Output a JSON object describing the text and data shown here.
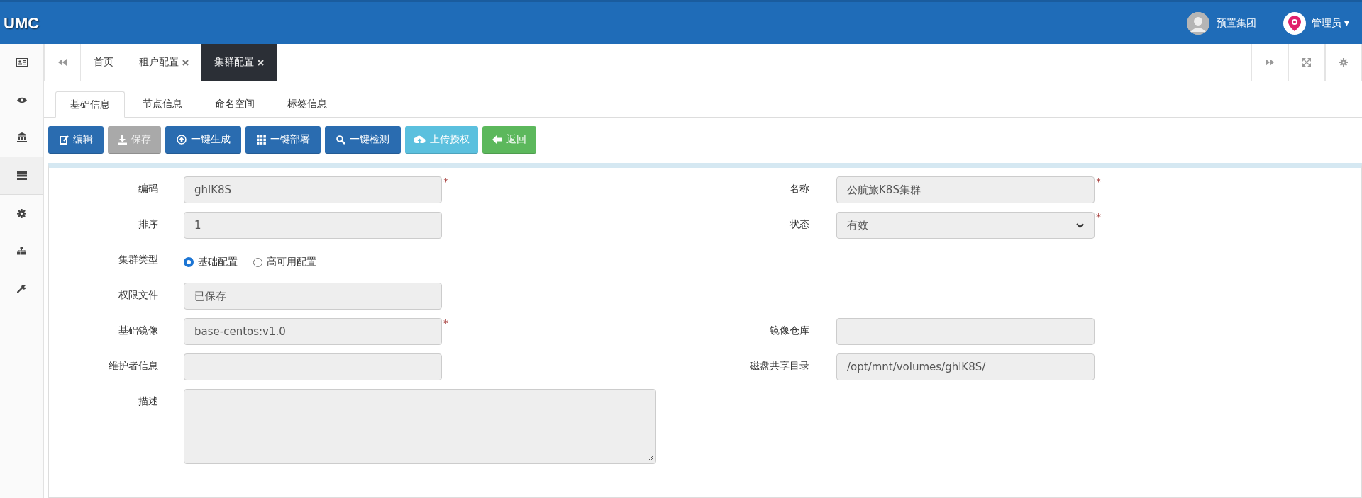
{
  "header": {
    "logo": "UMC",
    "org": {
      "name": "预置集团"
    },
    "user": {
      "name": "管理员",
      "caret": "▾"
    }
  },
  "sidebar": {
    "items": [
      {
        "selected": false
      },
      {
        "selected": false
      },
      {
        "selected": false
      },
      {
        "selected": true
      },
      {
        "selected": false
      },
      {
        "selected": false
      },
      {
        "selected": false
      }
    ]
  },
  "tabs": [
    {
      "label": "首页",
      "closable": false,
      "selected": false
    },
    {
      "label": "租户配置",
      "closable": true,
      "selected": false
    },
    {
      "label": "集群配置",
      "closable": true,
      "selected": true
    }
  ],
  "subtabs": [
    {
      "label": "基础信息",
      "selected": true
    },
    {
      "label": "节点信息",
      "selected": false
    },
    {
      "label": "命名空间",
      "selected": false
    },
    {
      "label": "标签信息",
      "selected": false
    }
  ],
  "toolbar": [
    {
      "label": "编辑",
      "kind": "primary"
    },
    {
      "label": "保存",
      "kind": "disabled"
    },
    {
      "label": "一键生成",
      "kind": "primary"
    },
    {
      "label": "一键部署",
      "kind": "primary"
    },
    {
      "label": "一键检测",
      "kind": "primary"
    },
    {
      "label": "上传授权",
      "kind": "info"
    },
    {
      "label": "返回",
      "kind": "success"
    }
  ],
  "form": {
    "rows": [
      {
        "fields": [
          {
            "label": "编码",
            "kind": "text",
            "value": "ghlK8S",
            "required_mark": "*"
          },
          {
            "label": "名称",
            "kind": "text",
            "value": "公航旅K8S集群",
            "required_mark": "*"
          }
        ]
      },
      {
        "fields": [
          {
            "label": "排序",
            "kind": "text",
            "value": "1"
          },
          {
            "label": "状态",
            "kind": "select",
            "value": "有效",
            "required_mark": "*"
          }
        ]
      },
      {
        "fields": [
          {
            "label": "集群类型",
            "kind": "radio",
            "options": [
              {
                "label": "基础配置",
                "selected": true
              },
              {
                "label": "高可用配置",
                "selected": false
              }
            ]
          }
        ]
      },
      {
        "fields": [
          {
            "label": "权限文件",
            "kind": "text",
            "value": "已保存"
          }
        ]
      },
      {
        "fields": [
          {
            "label": "基础镜像",
            "kind": "text",
            "value": "base-centos:v1.0",
            "required_mark": "*"
          },
          {
            "label": "镜像仓库",
            "kind": "text"
          }
        ]
      },
      {
        "fields": [
          {
            "label": "维护者信息",
            "kind": "text"
          },
          {
            "label": "磁盘共享目录",
            "kind": "text",
            "value": "/opt/mnt/volumes/ghlK8S/"
          }
        ]
      },
      {
        "fields": [
          {
            "label": "描述",
            "kind": "textarea"
          }
        ]
      }
    ]
  }
}
